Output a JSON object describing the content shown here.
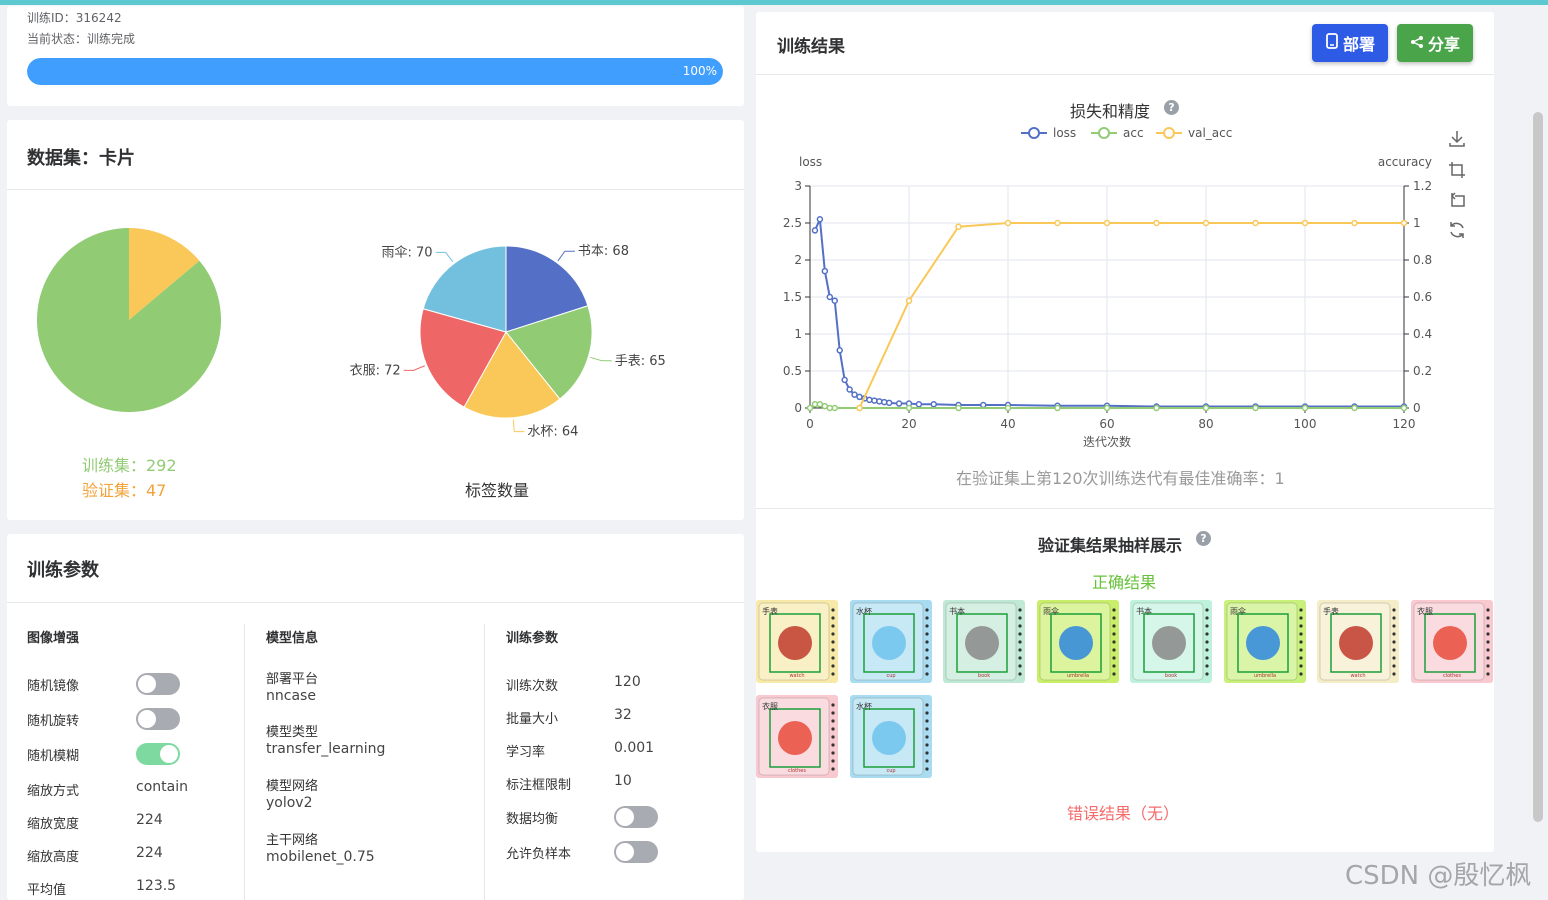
{
  "progress": {
    "training_id": "训练ID：316242",
    "status": "当前状态：训练完成",
    "percent": 100,
    "percent_label": "100%"
  },
  "dataset": {
    "title": "数据集：卡片",
    "train_label": "训练集：292",
    "val_label": "验证集：47",
    "split": {
      "train": 292,
      "val": 47
    },
    "label_chart_title": "标签数量",
    "labels": [
      {
        "name": "书本: 68",
        "value": 68,
        "color": "#5470c6"
      },
      {
        "name": "手表: 65",
        "value": 65,
        "color": "#91cc75"
      },
      {
        "name": "水杯: 64",
        "value": 64,
        "color": "#fac858"
      },
      {
        "name": "衣服: 72",
        "value": 72,
        "color": "#ee6666"
      },
      {
        "name": "雨伞: 70",
        "value": 70,
        "color": "#73c0de"
      }
    ]
  },
  "params": {
    "title": "训练参数",
    "aug_title": "图像增强",
    "aug": [
      {
        "label": "随机镜像",
        "on": false
      },
      {
        "label": "随机旋转",
        "on": false
      },
      {
        "label": "随机模糊",
        "on": true
      }
    ],
    "aug_values": [
      {
        "label": "缩放方式",
        "value": "contain"
      },
      {
        "label": "缩放宽度",
        "value": "224"
      },
      {
        "label": "缩放高度",
        "value": "224"
      },
      {
        "label": "平均值",
        "value": "123.5"
      }
    ],
    "model_title": "模型信息",
    "model": [
      {
        "label": "部署平台",
        "value": "nncase"
      },
      {
        "label": "模型类型",
        "value": "transfer_learning"
      },
      {
        "label": "模型网络",
        "value": "yolov2"
      },
      {
        "label": "主干网络",
        "value": "mobilenet_0.75"
      }
    ],
    "train_title": "训练参数",
    "train": [
      {
        "label": "训练次数",
        "value": "120"
      },
      {
        "label": "批量大小",
        "value": "32"
      },
      {
        "label": "学习率",
        "value": "0.001"
      },
      {
        "label": "标注框限制",
        "value": "10"
      }
    ],
    "train_switches": [
      {
        "label": "数据均衡",
        "on": false
      },
      {
        "label": "允许负样本",
        "on": false
      }
    ]
  },
  "results": {
    "title": "训练结果",
    "deploy_label": "部署",
    "share_label": "分享",
    "chart_title": "损失和精度",
    "best_text": "在验证集上第120次训练迭代有最佳准确率：1",
    "sample_title": "验证集结果抽样展示",
    "correct_title": "正确结果",
    "wrong_title": "错误结果（无）",
    "samples": [
      {
        "zh": "手表",
        "en": "watch",
        "bg": "#f7e9a8"
      },
      {
        "zh": "水杯",
        "en": "cup",
        "bg": "#a9dcf0"
      },
      {
        "zh": "书本",
        "en": "book",
        "bg": "#bfe9d4"
      },
      {
        "zh": "雨伞",
        "en": "umbrella",
        "bg": "#c9ef6a"
      },
      {
        "zh": "书本",
        "en": "book",
        "bg": "#bff2dc"
      },
      {
        "zh": "雨伞",
        "en": "umbrella",
        "bg": "#c8f07a"
      },
      {
        "zh": "手表",
        "en": "watch",
        "bg": "#f5ecc8"
      },
      {
        "zh": "衣服",
        "en": "clothes",
        "bg": "#f8c9cf"
      },
      {
        "zh": "衣服",
        "en": "clothes",
        "bg": "#f8c9cf"
      },
      {
        "zh": "水杯",
        "en": "cup",
        "bg": "#a9dcf0"
      }
    ]
  },
  "chart_data": {
    "type": "line",
    "title": "损失和精度",
    "xlabel": "迭代次数",
    "ylabel_left": "loss",
    "ylabel_right": "accuracy",
    "xlim": [
      0,
      120
    ],
    "ylim_left": [
      0,
      3
    ],
    "ylim_right": [
      0,
      1.2
    ],
    "x_ticks": [
      0,
      20,
      40,
      60,
      80,
      100,
      120
    ],
    "y_left_ticks": [
      "0",
      "0.5",
      "1",
      "1.5",
      "2",
      "2.5",
      "3"
    ],
    "y_right_ticks": [
      "0",
      "0.2",
      "0.4",
      "0.6",
      "0.8",
      "1",
      "1.2"
    ],
    "legend_placement": "top-center",
    "grid": true,
    "series": [
      {
        "name": "loss",
        "axis": "left",
        "color": "#5470c6",
        "x": [
          1,
          2,
          3,
          4,
          5,
          6,
          7,
          8,
          9,
          10,
          11,
          12,
          13,
          14,
          15,
          16,
          18,
          20,
          22,
          25,
          30,
          35,
          40,
          50,
          60,
          70,
          80,
          90,
          100,
          110,
          120
        ],
        "y": [
          2.4,
          2.55,
          1.85,
          1.5,
          1.45,
          0.78,
          0.38,
          0.25,
          0.18,
          0.15,
          0.13,
          0.11,
          0.1,
          0.09,
          0.08,
          0.07,
          0.06,
          0.06,
          0.05,
          0.05,
          0.04,
          0.04,
          0.04,
          0.03,
          0.03,
          0.02,
          0.02,
          0.02,
          0.02,
          0.02,
          0.02
        ]
      },
      {
        "name": "acc",
        "axis": "right",
        "color": "#91cc75",
        "x": [
          0,
          1,
          2,
          3,
          4,
          5,
          10,
          20,
          30,
          40,
          50,
          60,
          70,
          80,
          90,
          100,
          110,
          120
        ],
        "y": [
          0,
          0.02,
          0.02,
          0.01,
          0,
          0,
          0,
          0,
          0,
          0,
          0,
          0,
          0,
          0,
          0,
          0,
          0,
          0
        ]
      },
      {
        "name": "val_acc",
        "axis": "right",
        "color": "#fac858",
        "x": [
          10,
          20,
          30,
          40,
          50,
          60,
          70,
          80,
          90,
          100,
          110,
          120
        ],
        "y": [
          0,
          0.58,
          0.98,
          1,
          1,
          1,
          1,
          1,
          1,
          1,
          1,
          1
        ]
      }
    ]
  }
}
